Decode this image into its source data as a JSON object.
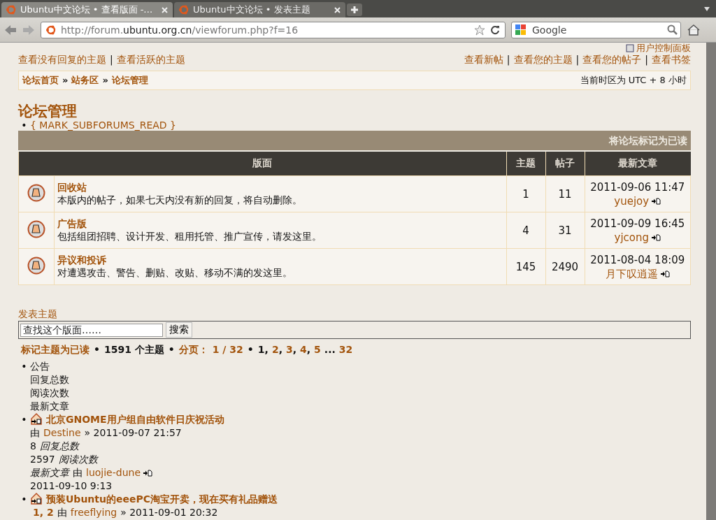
{
  "browser": {
    "tabs": [
      {
        "title": "Ubuntu中文论坛 • 查看版面 -…",
        "selected": true
      },
      {
        "title": "Ubuntu中文论坛 • 发表主题",
        "selected": false
      }
    ],
    "url": {
      "prefix": "http://forum.",
      "host": "ubuntu.org.cn",
      "path": "/viewforum.php?f=16"
    },
    "search": {
      "placeholder": "Google"
    }
  },
  "user_panel": "用户控制面板",
  "top_links_left": [
    {
      "label": "查看没有回复的主题"
    },
    {
      "sep": "|",
      "label": "查看活跃的主题"
    }
  ],
  "top_links_right": [
    {
      "label": "查看新帖"
    },
    {
      "sep": "|",
      "label": "查看您的主题"
    },
    {
      "sep": "|",
      "label": "查看您的帖子"
    },
    {
      "sep": "|",
      "label": "查看书签"
    }
  ],
  "breadcrumbs": [
    {
      "label": "论坛首页"
    },
    {
      "sep": "»",
      "label": "站务区"
    },
    {
      "sep": "»",
      "label": "论坛管理"
    }
  ],
  "timezone": "当前时区为 UTC + 8 小时",
  "forum_title": "论坛管理",
  "subforum_links": [
    {
      "bullet": "•",
      "label": "{ MARK_SUBFORUMS_READ }"
    }
  ],
  "mark_forums_read": "将论坛标记为已读",
  "table": {
    "columns": [
      "版面",
      "主题",
      "帖子",
      "最新文章"
    ],
    "rows": [
      {
        "name": "回收站",
        "description": "本版内的帖子，如果七天内没有新的回复，将自动删除。",
        "topics": "1",
        "posts": "11",
        "last_time": "2011-09-06 11:47",
        "last_user": "yuejoy"
      },
      {
        "name": "广告版",
        "description": "包括组团招聘、设计开发、租用托管、推广宣传，请发这里。",
        "topics": "4",
        "posts": "31",
        "last_time": "2011-09-09 16:45",
        "last_user": "yjcong"
      },
      {
        "name": "异议和投诉",
        "description": "对遭遇攻击、警告、删贴、改贴、移动不满的发这里。",
        "topics": "145",
        "posts": "2490",
        "last_time": "2011-08-04 18:09",
        "last_user": "月下叹逍遥"
      }
    ]
  },
  "new_topic": "发表主题",
  "forum_search": {
    "placeholder": "查找这个版面……",
    "button": "搜索"
  },
  "pagination": [
    {
      "kind": "link",
      "text": "标记主题为已读"
    },
    {
      "kind": "bullet",
      "text": "•"
    },
    {
      "kind": "text",
      "text": "1591 个主题"
    },
    {
      "kind": "bullet",
      "text": "•"
    },
    {
      "kind": "label",
      "text": "分页："
    },
    {
      "kind": "link",
      "text": "1 / 32"
    },
    {
      "kind": "bullet",
      "text": "•"
    },
    {
      "kind": "page",
      "text": "1",
      "selected": true
    },
    {
      "kind": "comma",
      "text": ","
    },
    {
      "kind": "page",
      "text": "2",
      "selected": false
    },
    {
      "kind": "comma",
      "text": ","
    },
    {
      "kind": "page",
      "text": "3",
      "selected": false
    },
    {
      "kind": "comma",
      "text": ","
    },
    {
      "kind": "page",
      "text": "4",
      "selected": false
    },
    {
      "kind": "comma",
      "text": ","
    },
    {
      "kind": "page",
      "text": "5",
      "selected": false
    },
    {
      "kind": "ellipsis",
      "text": "..."
    },
    {
      "kind": "page",
      "text": "32",
      "selected": false
    }
  ],
  "topic_list": [
    {
      "kind": "header",
      "bullet": "•",
      "title": "公告",
      "lines": [
        "回复总数",
        "阅读次数",
        "最新文章"
      ]
    },
    {
      "kind": "topic",
      "bullet": "•",
      "title": "北京GNOME用户组自由软件日庆祝活动",
      "by": "由",
      "author": "Destine",
      "time": "» 2011-09-07 21:57",
      "replies": "8",
      "replies_label": "回复总数",
      "views": "2597",
      "views_label": "阅读次数",
      "last_label": "最新文章",
      "last_by": "由",
      "last_user": "luojie-dune",
      "last_time": "2011-09-10 9:13"
    },
    {
      "kind": "topic_short",
      "bullet": "•",
      "title": "预装Ubuntu的eeePC淘宝开卖，现在买有礼品赠送",
      "pages": [
        {
          "label": "1",
          "sep": ","
        },
        {
          "label": "2"
        }
      ],
      "by": "由",
      "author": "freeflying",
      "time": "» 2011-09-01 20:32"
    }
  ]
}
